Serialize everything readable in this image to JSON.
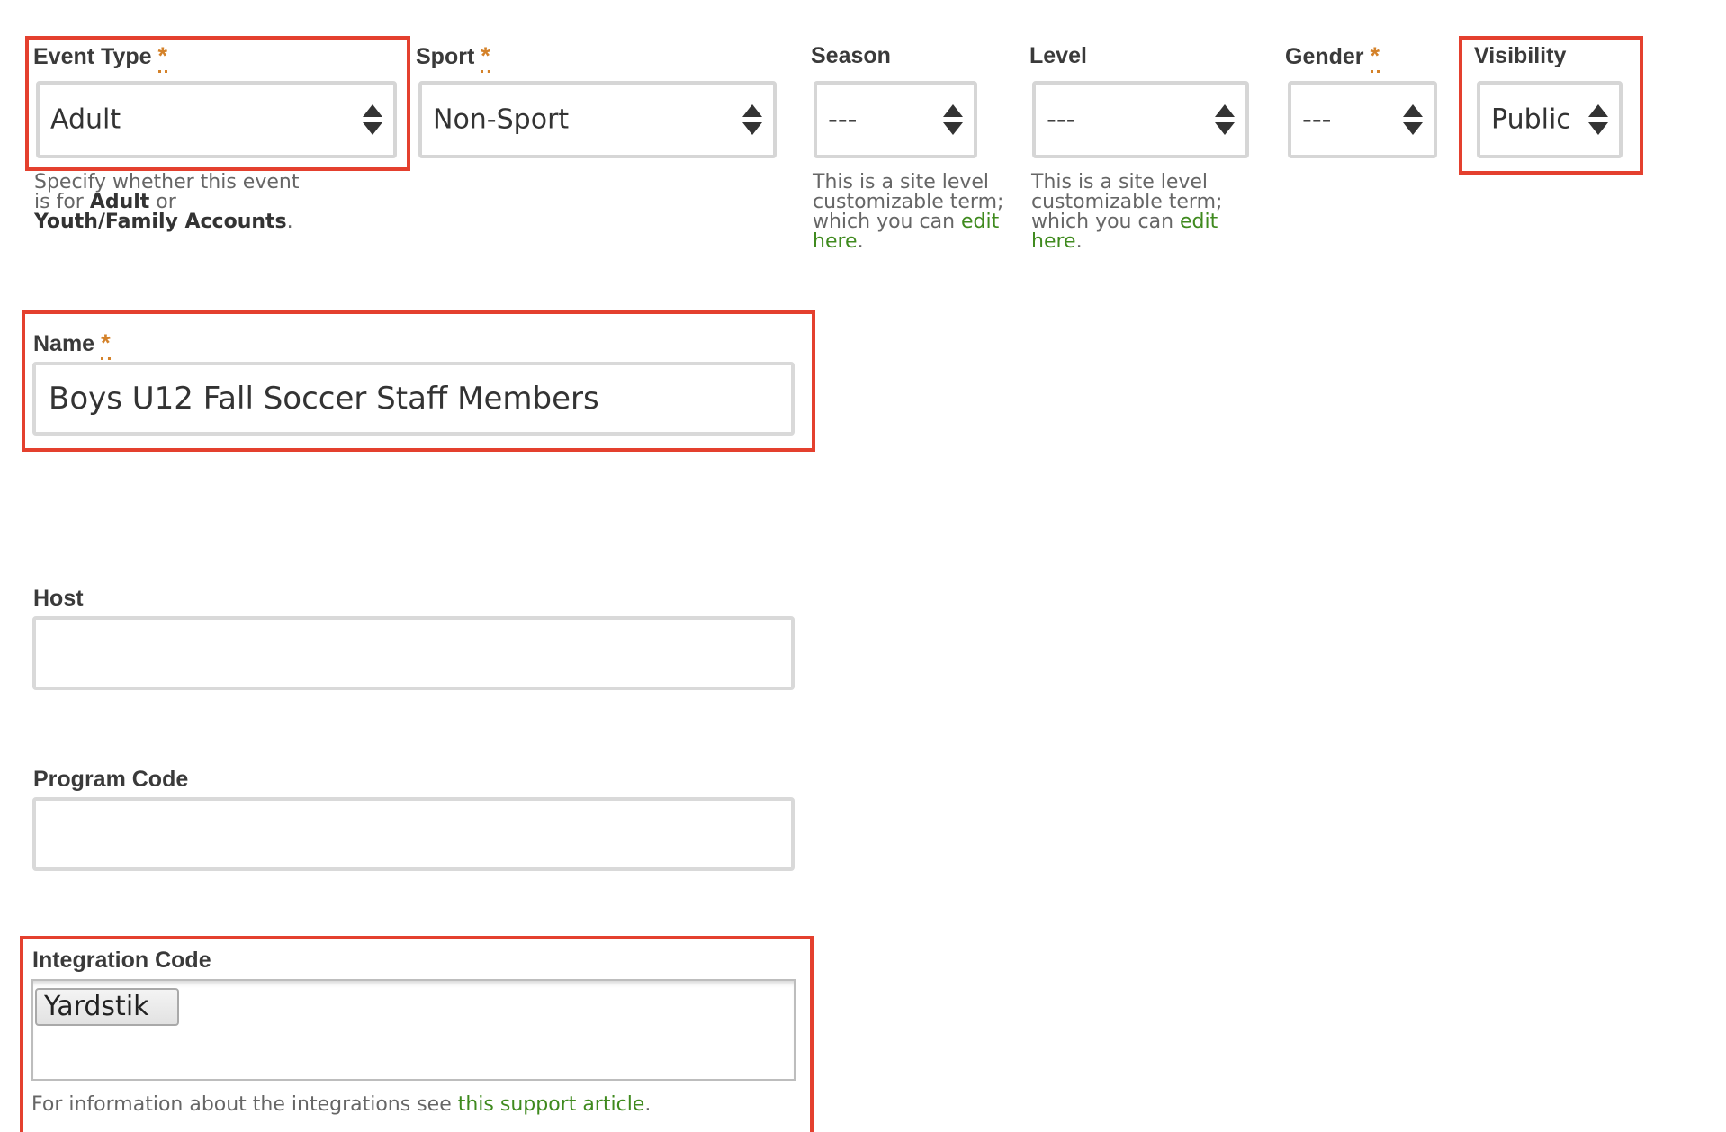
{
  "fields": {
    "event_type": {
      "label": "Event Type",
      "required_mark": "*",
      "value": "Adult",
      "help_prefix": "Specify whether this event is for ",
      "help_bold1": "Adult",
      "help_mid": " or ",
      "help_bold2": "Youth/Family Accounts",
      "help_suffix": "."
    },
    "sport": {
      "label": "Sport",
      "required_mark": "*",
      "value": "Non-Sport"
    },
    "season": {
      "label": "Season",
      "value": "---",
      "help_text": "This is a site level customizable term; which you can ",
      "help_link": "edit here",
      "help_suffix": "."
    },
    "level": {
      "label": "Level",
      "value": "---",
      "help_text": "This is a site level customizable term; which you can ",
      "help_link": "edit here",
      "help_suffix": "."
    },
    "gender": {
      "label": "Gender",
      "required_mark": "*",
      "value": "---"
    },
    "visibility": {
      "label": "Visibility",
      "value": "Public"
    },
    "name": {
      "label": "Name",
      "required_mark": "*",
      "value": "Boys U12 Fall Soccer Staff Members"
    },
    "host": {
      "label": "Host",
      "value": ""
    },
    "program_code": {
      "label": "Program Code",
      "value": ""
    },
    "integration_code": {
      "label": "Integration Code",
      "tag": "Yardstik",
      "help_text": "For information about the integrations see ",
      "help_link": "this support article",
      "help_suffix": "."
    }
  },
  "colors": {
    "highlight": "#e4402e",
    "required": "#d4822a",
    "link": "#3f8a1e"
  },
  "icons": {
    "select_arrows": "sort-arrows-icon"
  }
}
